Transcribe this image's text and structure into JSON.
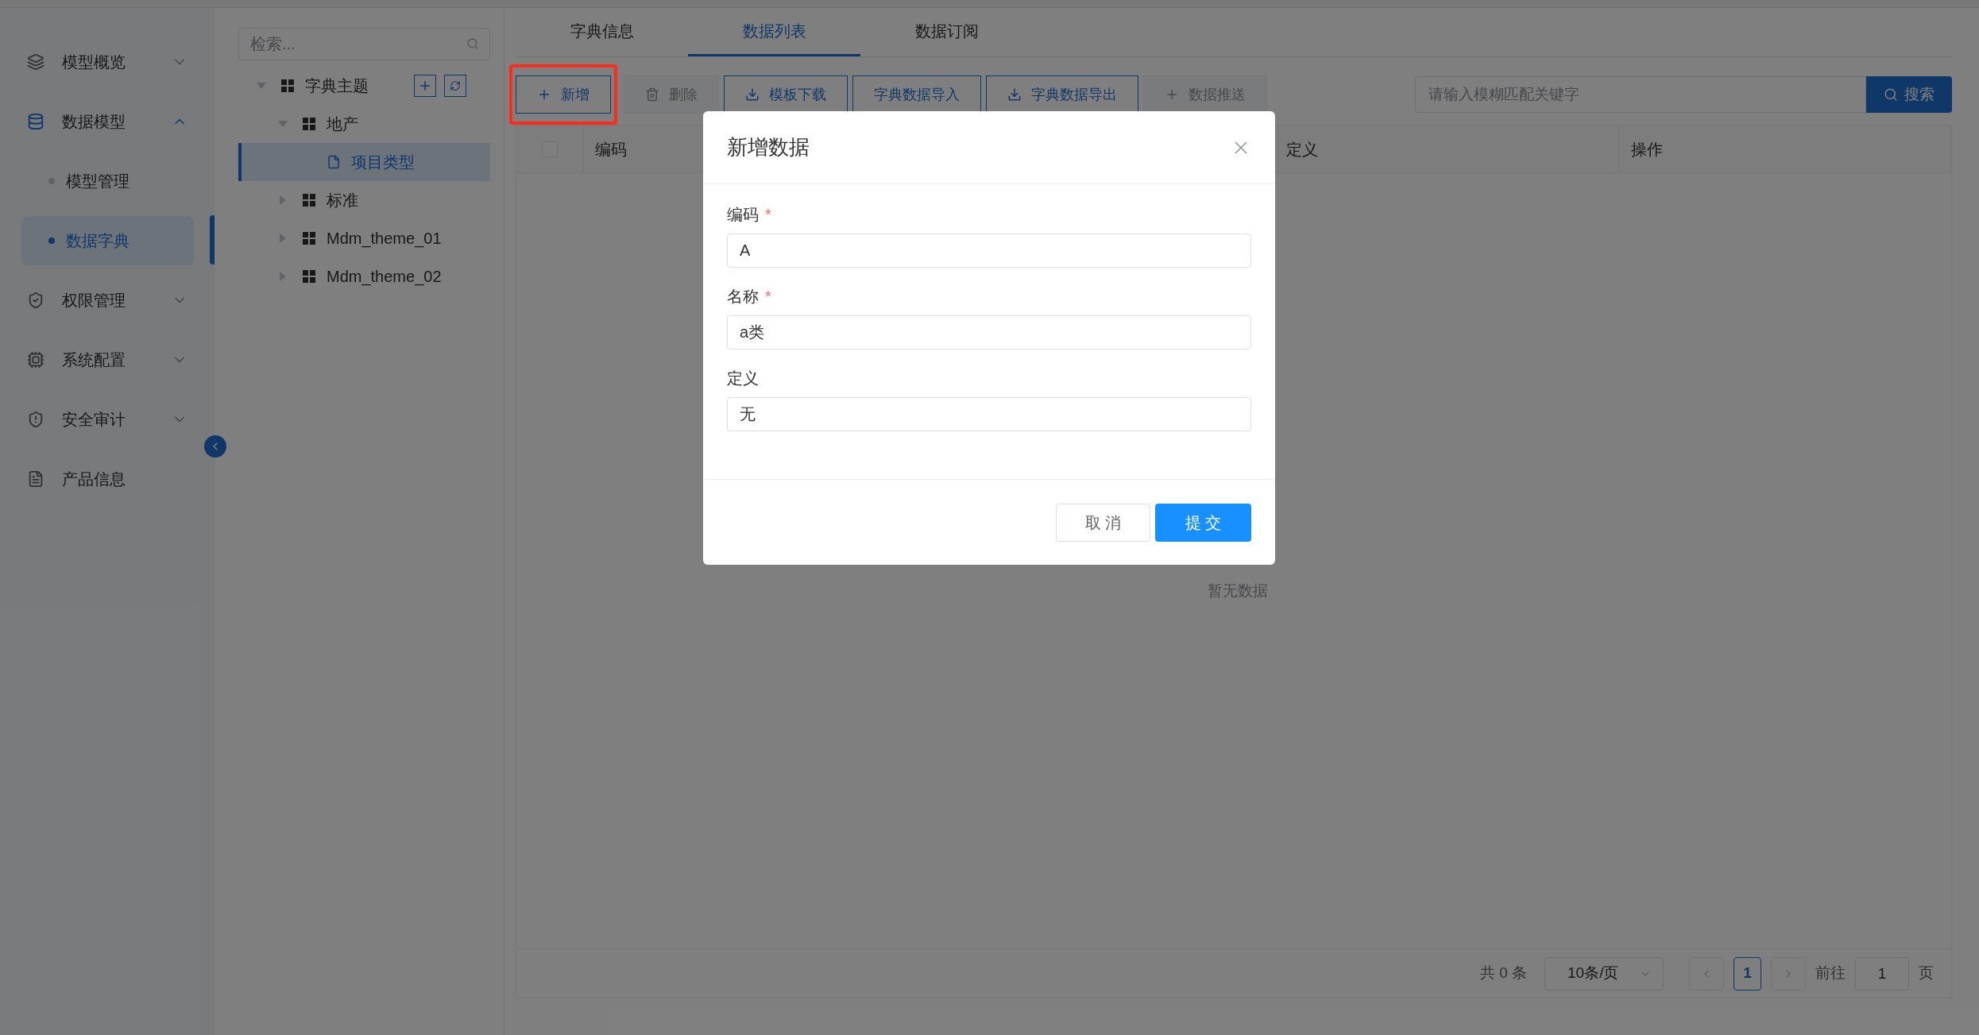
{
  "sidebar": {
    "items": [
      {
        "label": "模型概览",
        "expanded": false,
        "selected": false
      },
      {
        "label": "数据模型",
        "expanded": true,
        "selected": false,
        "children": [
          {
            "label": "模型管理",
            "selected": false
          },
          {
            "label": "数据字典",
            "selected": true
          }
        ]
      },
      {
        "label": "权限管理",
        "expanded": false,
        "selected": false
      },
      {
        "label": "系统配置",
        "expanded": false,
        "selected": false
      },
      {
        "label": "安全审计",
        "expanded": false,
        "selected": false
      },
      {
        "label": "产品信息",
        "selected": false
      }
    ]
  },
  "tree": {
    "search": {
      "placeholder": "检索..."
    },
    "nodes": [
      {
        "label": "字典主题",
        "kind": "folder",
        "expanded": true,
        "selected": false,
        "children": [
          {
            "label": "地产",
            "kind": "folder",
            "expanded": true,
            "selected": false,
            "children": [
              {
                "label": "项目类型",
                "kind": "file",
                "selected": true
              }
            ]
          },
          {
            "label": "标准",
            "kind": "folder",
            "expanded": false,
            "selected": false
          },
          {
            "label": "Mdm_theme_01",
            "kind": "folder",
            "expanded": false,
            "selected": false
          },
          {
            "label": "Mdm_theme_02",
            "kind": "folder",
            "expanded": false,
            "selected": false
          }
        ]
      }
    ]
  },
  "tabs": [
    {
      "label": "字典信息",
      "selected": false
    },
    {
      "label": "数据列表",
      "selected": true
    },
    {
      "label": "数据订阅",
      "selected": false
    }
  ],
  "toolbar": [
    {
      "label": "新增",
      "disabled": false,
      "highlighted": true
    },
    {
      "label": "删除",
      "disabled": true,
      "highlighted": false
    },
    {
      "label": "模板下载",
      "disabled": false,
      "highlighted": false
    },
    {
      "label": "字典数据导入",
      "disabled": false,
      "highlighted": false
    },
    {
      "label": "字典数据导出",
      "disabled": false,
      "highlighted": false
    },
    {
      "label": "数据推送",
      "disabled": true,
      "highlighted": false
    }
  ],
  "search": {
    "placeholder": "请输入模糊匹配关键字",
    "button": "搜索"
  },
  "table": {
    "select_all": {
      "checked": false
    },
    "columns": [
      "编码",
      "定义",
      "操作"
    ],
    "empty_text": "暂无数据"
  },
  "pagination": {
    "total": "共 0 条",
    "page_size": "10条/页",
    "pages": [
      {
        "label": "1",
        "selected": true
      }
    ],
    "goto_label": "前往",
    "goto_value": "1",
    "goto_suffix": "页"
  },
  "dialog": {
    "title": "新增数据",
    "fields": [
      {
        "label": "编码",
        "required_mark": "*",
        "value": "A"
      },
      {
        "label": "名称",
        "required_mark": "*",
        "value": "a类"
      },
      {
        "label": "定义",
        "value": "无"
      }
    ],
    "cancel": "取 消",
    "submit": "提 交"
  }
}
